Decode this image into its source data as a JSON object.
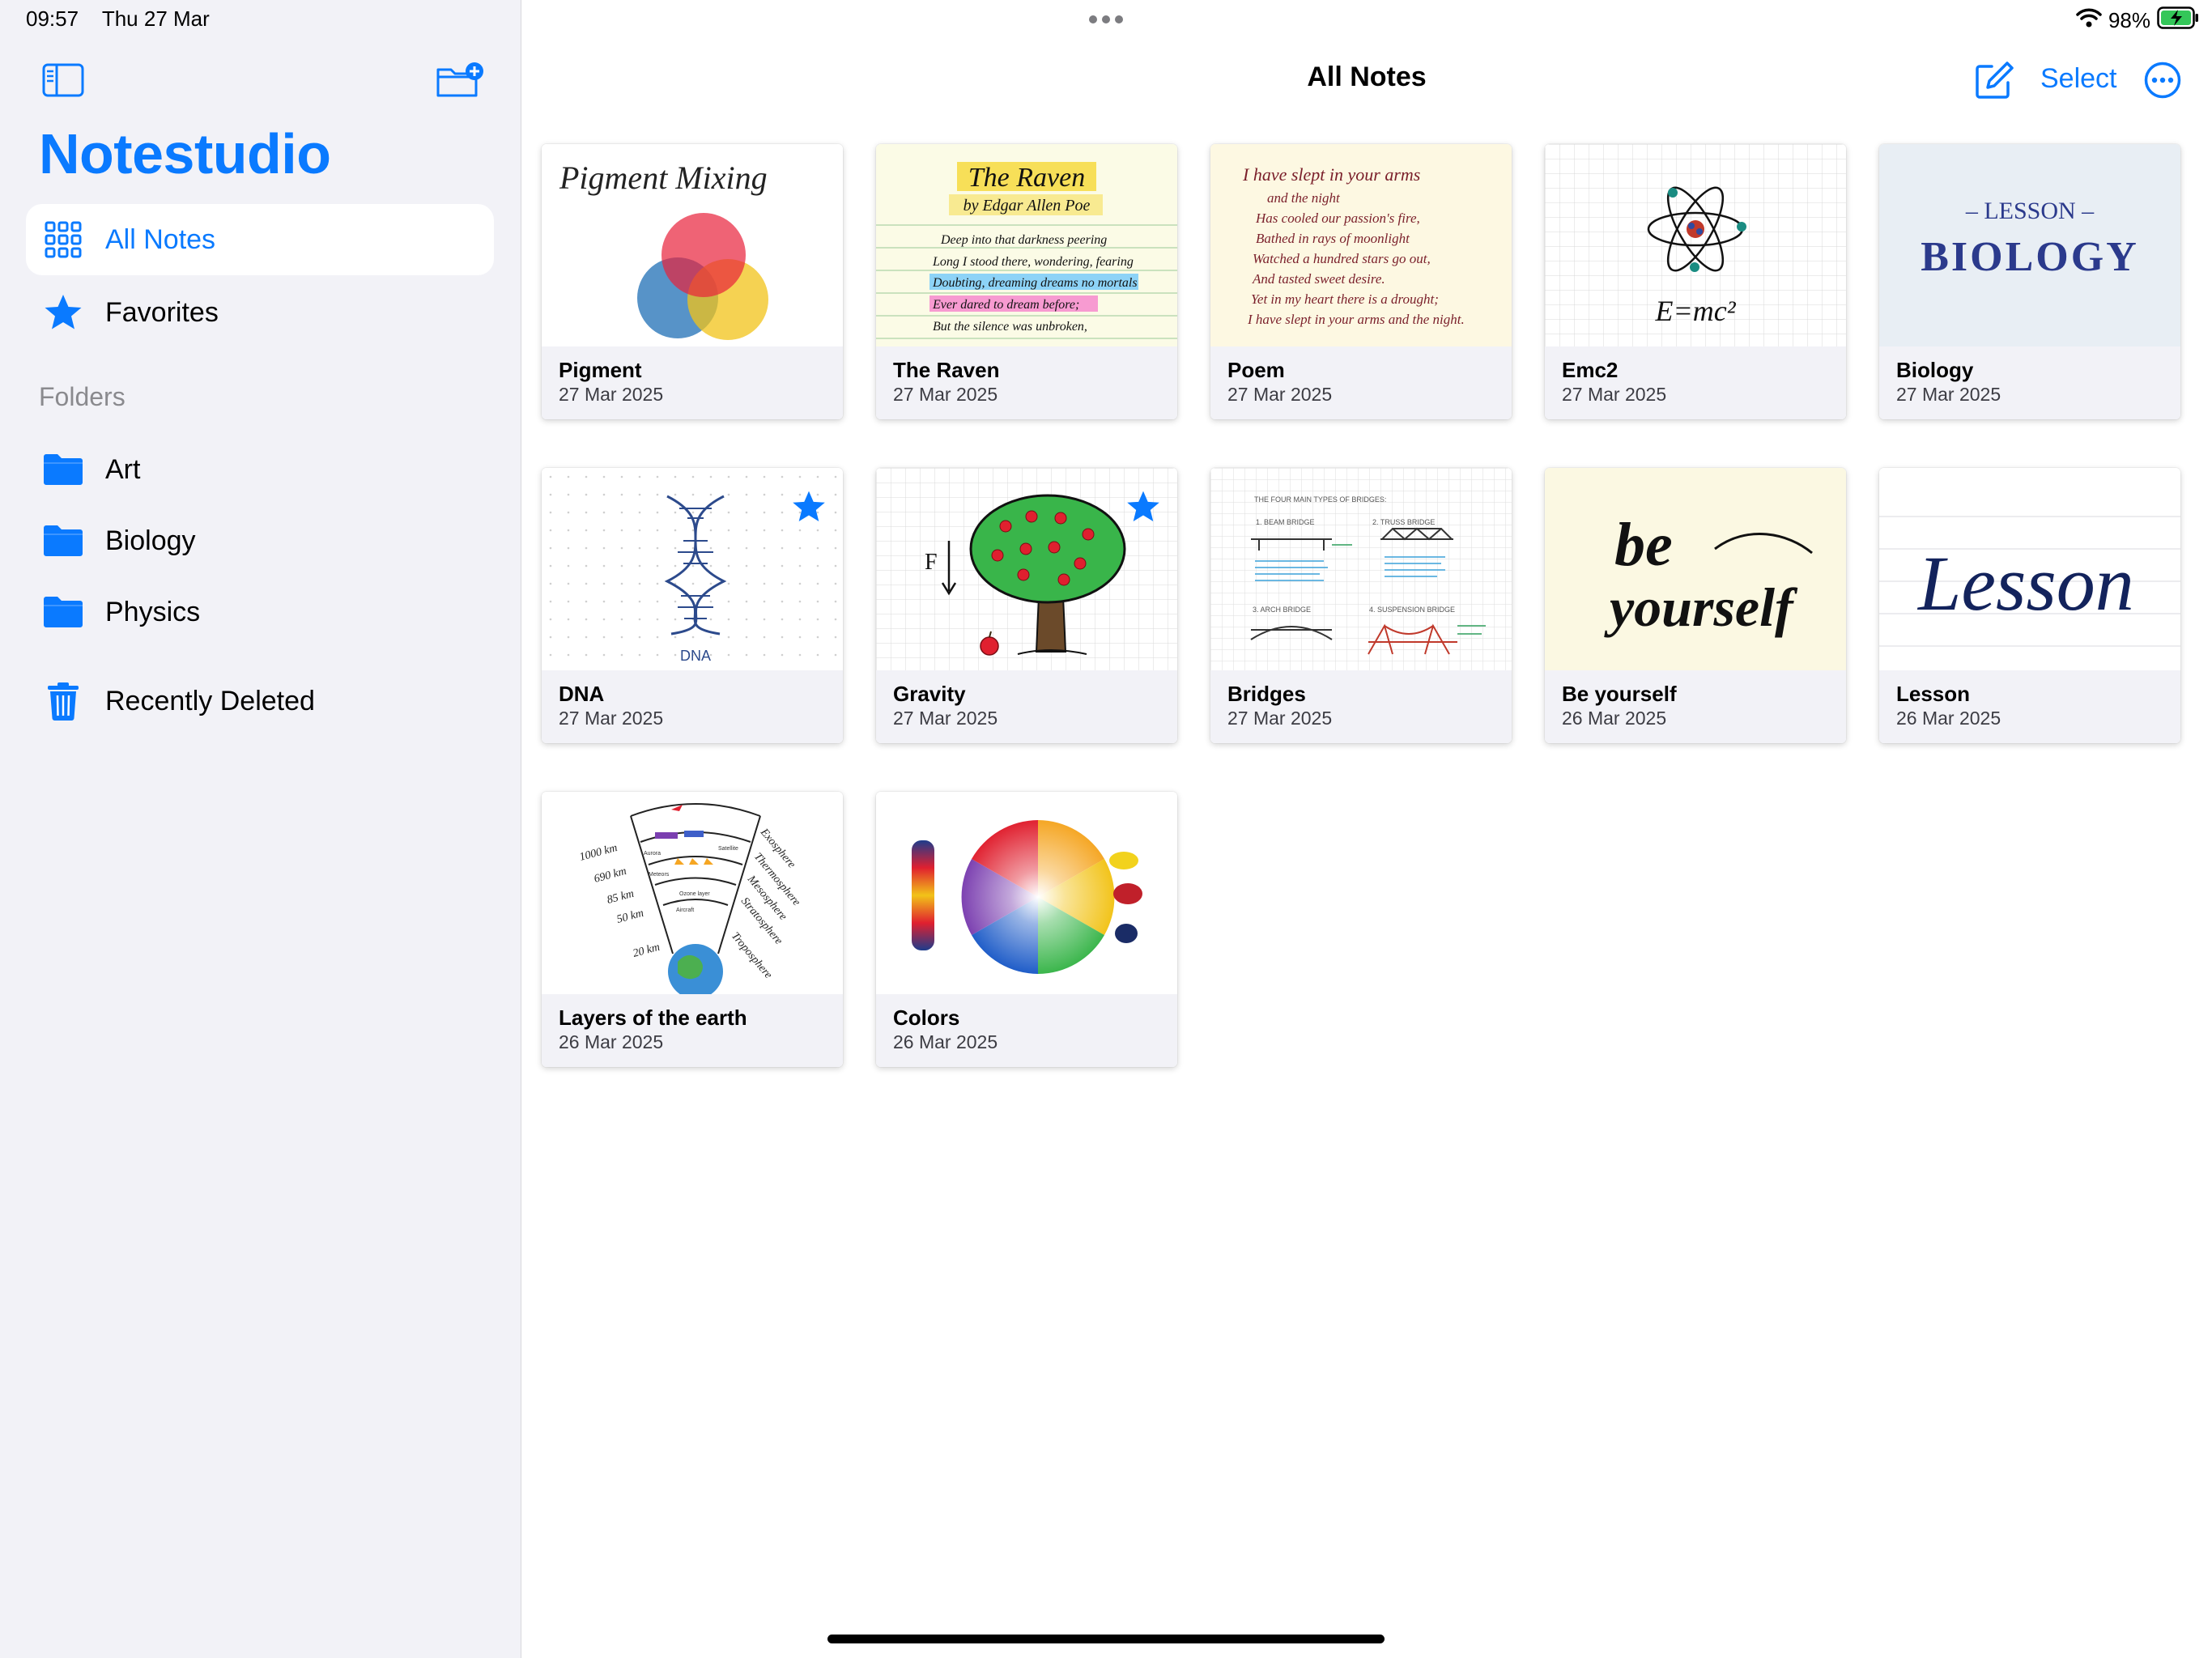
{
  "status": {
    "time": "09:57",
    "date": "Thu 27 Mar",
    "battery": "98%"
  },
  "sidebar": {
    "app_title": "Notestudio",
    "nav": [
      {
        "label": "All Notes",
        "icon": "grid-icon"
      },
      {
        "label": "Favorites",
        "icon": "star-icon"
      }
    ],
    "folders_heading": "Folders",
    "folders": [
      {
        "label": "Art",
        "icon": "folder-icon"
      },
      {
        "label": "Biology",
        "icon": "folder-icon"
      },
      {
        "label": "Physics",
        "icon": "folder-icon"
      }
    ],
    "recently_deleted": "Recently Deleted"
  },
  "header": {
    "title": "All Notes",
    "select_label": "Select"
  },
  "notes": [
    {
      "name": "Pigment",
      "date": "27 Mar 2025",
      "favorite": false,
      "thumb_text": [
        "Pigment Mixing"
      ]
    },
    {
      "name": "The Raven",
      "date": "27 Mar 2025",
      "favorite": false,
      "thumb_text": [
        "The Raven",
        "by Edgar Allen Poe",
        "Deep into that darkness peering",
        "Long I stood there, wondering, fearing",
        "Doubting, dreaming dreams no mortals",
        "Ever dared to dream before;",
        "But the silence was unbroken,"
      ]
    },
    {
      "name": "Poem",
      "date": "27 Mar 2025",
      "favorite": false,
      "thumb_text": [
        "I have slept in your arms",
        "and the night",
        "Has cooled our passion's fire,",
        "Bathed in rays of moonlight",
        "Watched a hundred stars go out,",
        "And tasted sweet desire.",
        "Yet in my heart there is a drought;",
        "I have slept in your arms and the night."
      ]
    },
    {
      "name": "Emc2",
      "date": "27 Mar 2025",
      "favorite": false,
      "thumb_text": [
        "E=mc²"
      ]
    },
    {
      "name": "Biology",
      "date": "27 Mar 2025",
      "favorite": false,
      "thumb_text": [
        "– LESSON –",
        "BIOLOGY"
      ]
    },
    {
      "name": "DNA",
      "date": "27 Mar 2025",
      "favorite": true,
      "thumb_text": [
        "DNA"
      ]
    },
    {
      "name": "Gravity",
      "date": "27 Mar 2025",
      "favorite": true,
      "thumb_text": [
        "F"
      ]
    },
    {
      "name": "Bridges",
      "date": "27 Mar 2025",
      "favorite": false,
      "thumb_text": [
        "THE FOUR MAIN TYPES OF BRIDGES:",
        "1. BEAM BRIDGE",
        "2. TRUSS BRIDGE",
        "3. ARCH BRIDGE",
        "4. SUSPENSION BRIDGE"
      ]
    },
    {
      "name": "Be yourself",
      "date": "26 Mar 2025",
      "favorite": false,
      "thumb_text": [
        "be",
        "yourself"
      ]
    },
    {
      "name": "Lesson",
      "date": "26 Mar 2025",
      "favorite": false,
      "thumb_text": [
        "Lesson"
      ]
    },
    {
      "name": "Layers of the earth",
      "date": "26 Mar 2025",
      "favorite": false,
      "thumb_text": [
        "1000 km",
        "690 km",
        "85 km",
        "50 km",
        "20 km",
        "Exosphere",
        "Thermosphere",
        "Mesosphere",
        "Stratosphere",
        "Troposphere",
        "Aurora",
        "Satellite",
        "Meteors",
        "Ozone layer",
        "Aircraft"
      ]
    },
    {
      "name": "Colors",
      "date": "26 Mar 2025",
      "favorite": false,
      "thumb_text": []
    }
  ],
  "colors": {
    "accent": "#0a7aff",
    "sidebar_bg": "#f2f2f7",
    "card_meta_bg": "#f2f2f7",
    "battery_fill": "#34c759"
  }
}
